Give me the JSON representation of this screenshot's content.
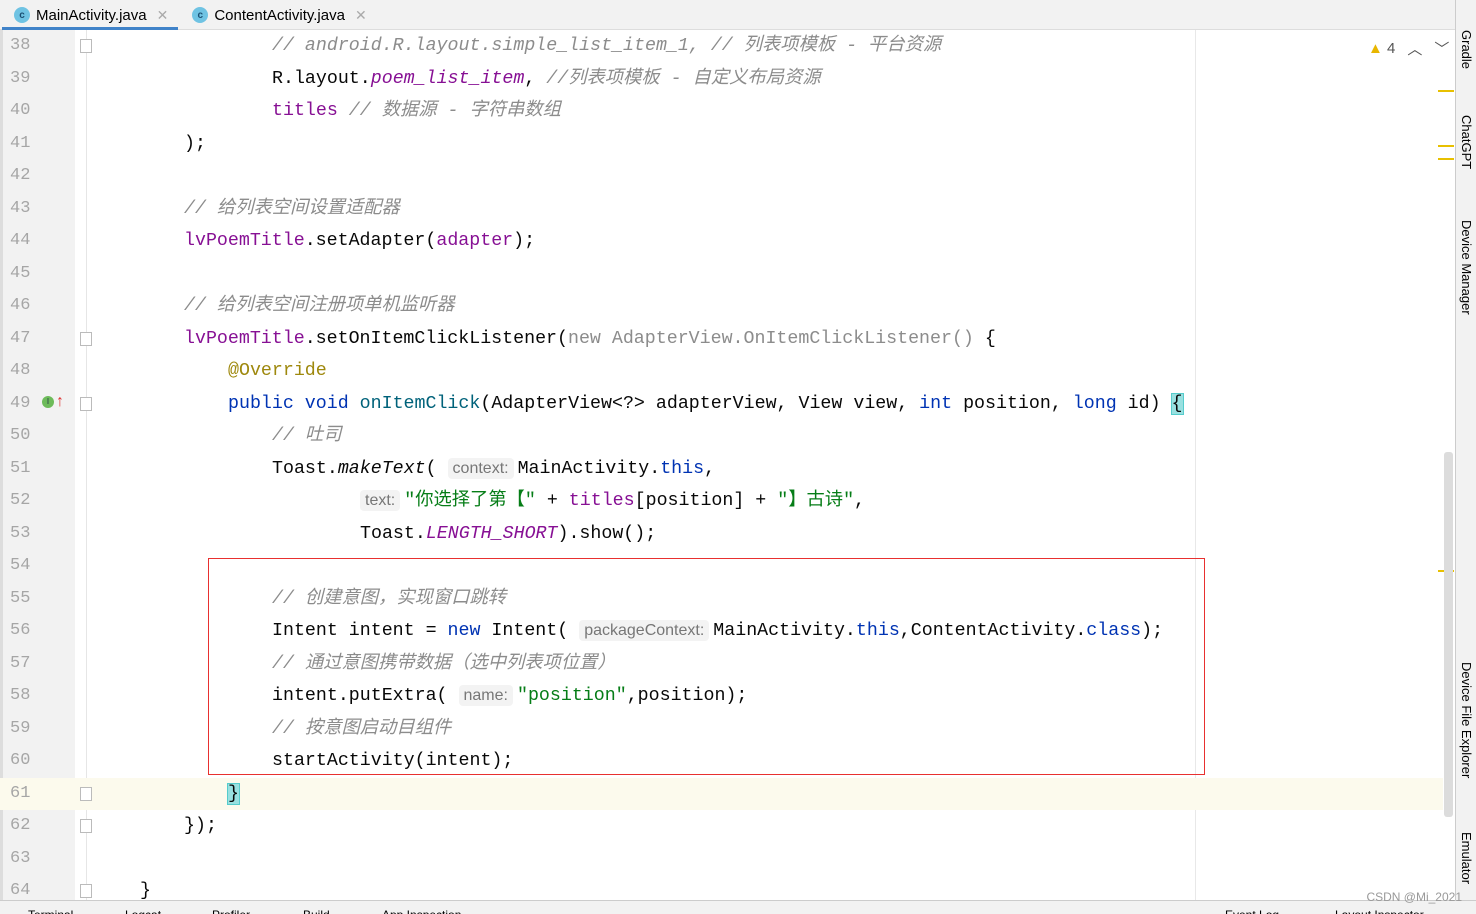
{
  "tabs": [
    {
      "label": "MainActivity.java",
      "icon": "class-icon",
      "active": true
    },
    {
      "label": "ContentActivity.java",
      "icon": "class-icon",
      "active": false
    }
  ],
  "inspections": {
    "warning_count": "4"
  },
  "right_tools": [
    "Gradle",
    "ChatGPT",
    "Device Manager",
    "Device File Explorer",
    "Emulator"
  ],
  "watermark": "CSDN @Mi_2021",
  "current_line": 61,
  "colors": {
    "keyword": "#0033b3",
    "field": "#871094",
    "comment": "#8c8c8c",
    "string": "#067d17",
    "highlight_box": "#e8302f"
  },
  "lines": [
    {
      "n": 38,
      "indent": 16,
      "t": [
        [
          "cm",
          "// android.R.layout.simple_list_item_1, // 列表项模板 - 平台资源"
        ]
      ]
    },
    {
      "n": 39,
      "indent": 16,
      "t": [
        [
          "",
          "R.layout."
        ],
        [
          "fdi",
          "poem_list_item"
        ],
        [
          "",
          ", "
        ],
        [
          "cm",
          "//列表项模板 - 自定义布局资源"
        ]
      ]
    },
    {
      "n": 40,
      "indent": 16,
      "t": [
        [
          "fd",
          "titles"
        ],
        [
          "cm",
          " // 数据源 - 字符串数组"
        ]
      ]
    },
    {
      "n": 41,
      "indent": 8,
      "t": [
        [
          "",
          ");"
        ]
      ]
    },
    {
      "n": 42,
      "indent": 0,
      "t": []
    },
    {
      "n": 43,
      "indent": 8,
      "t": [
        [
          "cm",
          "// 给列表空间设置适配器"
        ]
      ]
    },
    {
      "n": 44,
      "indent": 8,
      "t": [
        [
          "fd",
          "lvPoemTitle"
        ],
        [
          "",
          ".setAdapter("
        ],
        [
          "fd",
          "adapter"
        ],
        [
          "",
          ");"
        ]
      ]
    },
    {
      "n": 45,
      "indent": 0,
      "t": []
    },
    {
      "n": 46,
      "indent": 8,
      "t": [
        [
          "cm",
          "// 给列表空间注册项单机监听器"
        ]
      ]
    },
    {
      "n": 47,
      "indent": 8,
      "t": [
        [
          "fd",
          "lvPoemTitle"
        ],
        [
          "",
          ".setOnItemClickListener("
        ],
        [
          "cm2",
          "new AdapterView.OnItemClickListener()"
        ],
        [
          "",
          " {"
        ]
      ]
    },
    {
      "n": 48,
      "indent": 12,
      "t": [
        [
          "an",
          "@Override"
        ]
      ]
    },
    {
      "n": 49,
      "indent": 12,
      "t": [
        [
          "kw",
          "public void "
        ],
        [
          "mt",
          "onItemClick"
        ],
        [
          "",
          "(AdapterView<?> adapterView, View view, "
        ],
        [
          "kw",
          "int"
        ],
        [
          "",
          " position, "
        ],
        [
          "kw",
          "long"
        ],
        [
          "",
          " id) "
        ],
        [
          "brk",
          "{"
        ]
      ]
    },
    {
      "n": 50,
      "indent": 16,
      "t": [
        [
          "cm",
          "// 吐司"
        ]
      ]
    },
    {
      "n": 51,
      "indent": 16,
      "t": [
        [
          "",
          "Toast."
        ],
        [
          "it",
          "makeText"
        ],
        [
          "",
          "( "
        ],
        [
          "hint",
          "context:"
        ],
        [
          "",
          "MainActivity."
        ],
        [
          "kw",
          "this"
        ],
        [
          "",
          ","
        ]
      ]
    },
    {
      "n": 52,
      "indent": 24,
      "t": [
        [
          "hint",
          "text:"
        ],
        [
          "st",
          "\"你选择了第【\""
        ],
        [
          "",
          " + "
        ],
        [
          "fd",
          "titles"
        ],
        [
          "",
          "[position] + "
        ],
        [
          "st",
          "\"】古诗\""
        ],
        [
          "",
          ","
        ]
      ]
    },
    {
      "n": 53,
      "indent": 24,
      "t": [
        [
          "",
          "Toast."
        ],
        [
          "fdi",
          "LENGTH_SHORT"
        ],
        [
          "",
          ").show();"
        ]
      ]
    },
    {
      "n": 54,
      "indent": 0,
      "t": []
    },
    {
      "n": 55,
      "indent": 16,
      "t": [
        [
          "cm",
          "// 创建意图，实现窗口跳转"
        ]
      ]
    },
    {
      "n": 56,
      "indent": 16,
      "t": [
        [
          "",
          "Intent intent = "
        ],
        [
          "kw",
          "new"
        ],
        [
          "",
          " Intent( "
        ],
        [
          "hint",
          "packageContext:"
        ],
        [
          "",
          "MainActivity."
        ],
        [
          "kw",
          "this"
        ],
        [
          "",
          ",ContentActivity."
        ],
        [
          "kw",
          "class"
        ],
        [
          "",
          ");"
        ]
      ]
    },
    {
      "n": 57,
      "indent": 16,
      "t": [
        [
          "cm",
          "// 通过意图携带数据（选中列表项位置）"
        ]
      ]
    },
    {
      "n": 58,
      "indent": 16,
      "t": [
        [
          "",
          "intent.putExtra( "
        ],
        [
          "hint",
          "name:"
        ],
        [
          "st",
          "\"position\""
        ],
        [
          "",
          ",position);"
        ]
      ]
    },
    {
      "n": 59,
      "indent": 16,
      "t": [
        [
          "cm",
          "// 按意图启动目组件"
        ]
      ]
    },
    {
      "n": 60,
      "indent": 16,
      "t": [
        [
          "",
          "startActivity(intent);"
        ]
      ]
    },
    {
      "n": 61,
      "indent": 12,
      "t": [
        [
          "brk",
          "}"
        ]
      ]
    },
    {
      "n": 62,
      "indent": 8,
      "t": [
        [
          "",
          "});"
        ]
      ]
    },
    {
      "n": 63,
      "indent": 0,
      "t": []
    },
    {
      "n": 64,
      "indent": 4,
      "t": [
        [
          "",
          "}"
        ]
      ]
    }
  ],
  "bottom_tools": [
    "Terminal",
    "Logcat",
    "Profiler",
    "Build",
    "App Inspection",
    "Event Log",
    "Layout Inspector"
  ]
}
